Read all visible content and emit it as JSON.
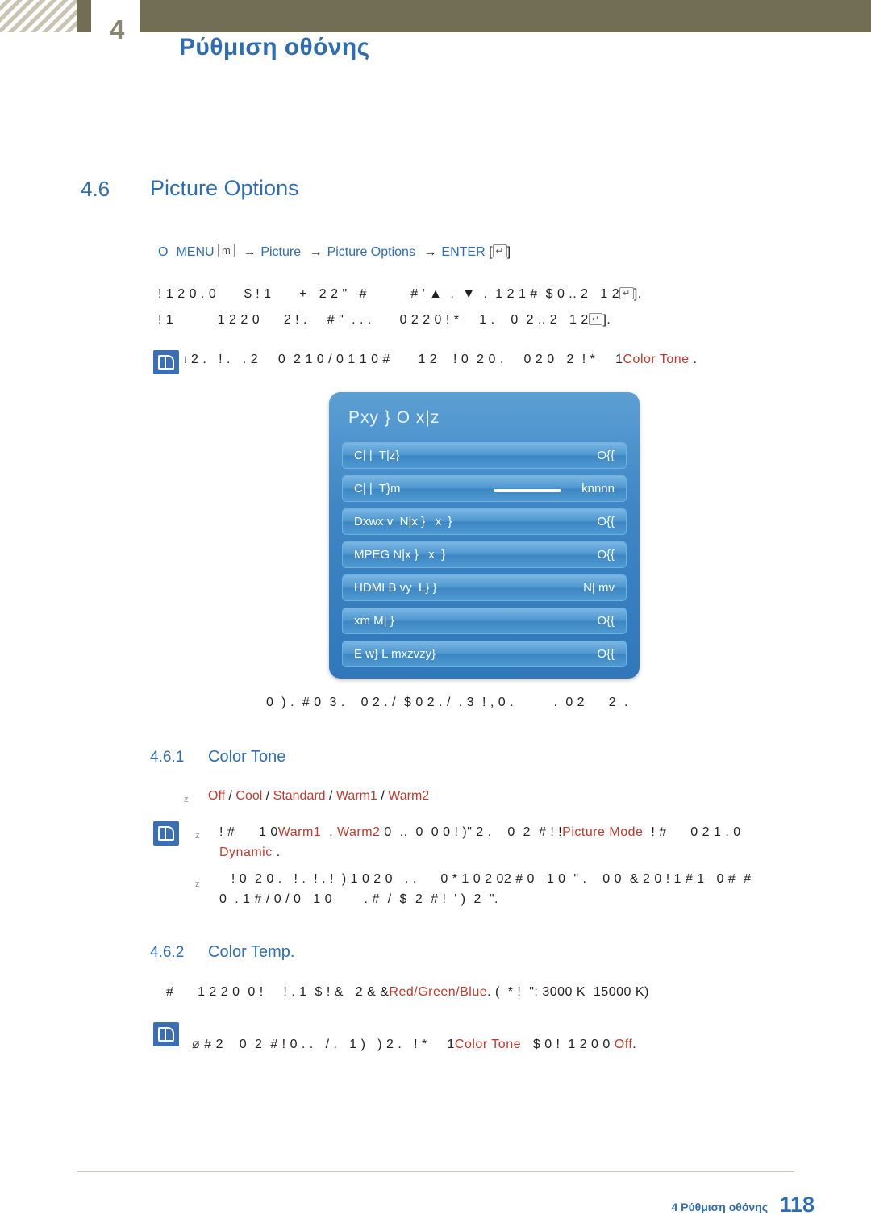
{
  "header": {
    "chapter_number": "4",
    "title": "Ρύθμιση οθόνης"
  },
  "section": {
    "number": "4.6",
    "title": "Picture Options"
  },
  "path": {
    "bullet": "O",
    "menu": "MENU",
    "menu_key": "m",
    "arrow": "→",
    "picture": "Picture",
    "picture_options": "Picture Options",
    "enter": "ENTER",
    "enter_key": "↵"
  },
  "body": {
    "line1_a": "! 1 2 0 . 0",
    "line1_b": "$ ! 1",
    "line1_c": "+   2 2 \"   #",
    "line1_d": "# ' ▲",
    "line1_e": ".  ▼",
    "line1_f": ".  1 2 1 #",
    "line1_g": "$ 0 .. 2   1 2",
    "line1_h": "].",
    "line2_a": "! 1",
    "line2_b": "1 2 2 0",
    "line2_c": "2 ! .",
    "line2_d": "# \"  . . .",
    "line2_e": "0 2 2 0 ! *",
    "line2_f": "1 .",
    "line2_g": "0  2 .. 2   1 2",
    "line2_h": "].",
    "note1_a": "ι 2 .   ! .   . 2",
    "note1_b": "0  2 1 0 / 0 1 1 0 #",
    "note1_c": "1 2",
    "note1_d": "! 0  2 0 .",
    "note1_e": "0 2 0",
    "note1_f": "2  ! *",
    "note1_ref": "Color Tone",
    "note1_end": ".",
    "caption": "0  ) .  # 0  3 .    0 2 . /  $ 0 2 . /  . 3  ! , 0 .          .  0 2      2  ."
  },
  "osd": {
    "title": "Pxy  } O  x|z",
    "rows": [
      {
        "label": "C| |  T|z}",
        "value": "O{{",
        "slider": false
      },
      {
        "label": "C| |  T}m",
        "value": "knnnn",
        "slider": true
      },
      {
        "label": "Dxwx v  N|x }   x  }",
        "value": "O{{",
        "slider": false
      },
      {
        "label": "MPEG N|x }   x  }",
        "value": "O{{",
        "slider": false
      },
      {
        "label": "HDMI B vy  L} }",
        "value": "N| mv",
        "slider": false
      },
      {
        "label": "xm M| }",
        "value": "O{{",
        "slider": false
      },
      {
        "label": "E w} L mxzvzy}",
        "value": "O{{",
        "slider": false
      }
    ]
  },
  "subsection1": {
    "number": "4.6.1",
    "title": "Color Tone",
    "options": [
      "Off",
      "Cool",
      "Standard",
      "Warm1",
      "Warm2"
    ],
    "note_a": "! #",
    "note_b": "1 0",
    "note_warm1": "Warm1",
    "note_c": ".",
    "note_warm2": "Warm2",
    "note_d": "0  ..  0  0 0 !",
    "note_e": ")\" 2 .",
    "note_f": "0  2  # !",
    "note_picture_mode": "Picture Mode",
    "note_g": "! #",
    "note_h": "0 2 1 . 0",
    "note_dynamic": "Dynamic",
    "note_i": ".",
    "note2_a": "! 0  2 0 .   ! .  ! . !  ) 1 0 2 0   . .",
    "note2_b": "0 * 1 0 2 0",
    "note2_c": "2 # 0",
    "note2_d": "1 0  \" .",
    "note2_e": "0 0  & 2 0 ! 1 # 1   0 #  #",
    "note2_f": "0  . 1 # / 0 / 0   1 0",
    "note2_g": ". #  /  $  2  # !  ' )  2  \"."
  },
  "subsection2": {
    "number": "4.6.2",
    "title": "Color Temp.",
    "line_a": "#",
    "line_b": "1 2 2 0  0 !",
    "line_c": "! . 1  $ ! &",
    "line_d": "2 &",
    "rgb": "Red/Green/Blue",
    "line_e": ". (  * !  \": 3000 K  15000 K)",
    "note_a": "ø # 2",
    "note_b": "0  2  # ! 0 . .   / .   1 )",
    "note_c": ") 2 .   ! *",
    "note_ref": "Color Tone",
    "note_d": "$ 0 !  1 2 0 0",
    "note_off": "Off",
    "note_e": "."
  },
  "footer": {
    "chapter": "4 Ρύθμιση οθόνης",
    "page": "118"
  }
}
